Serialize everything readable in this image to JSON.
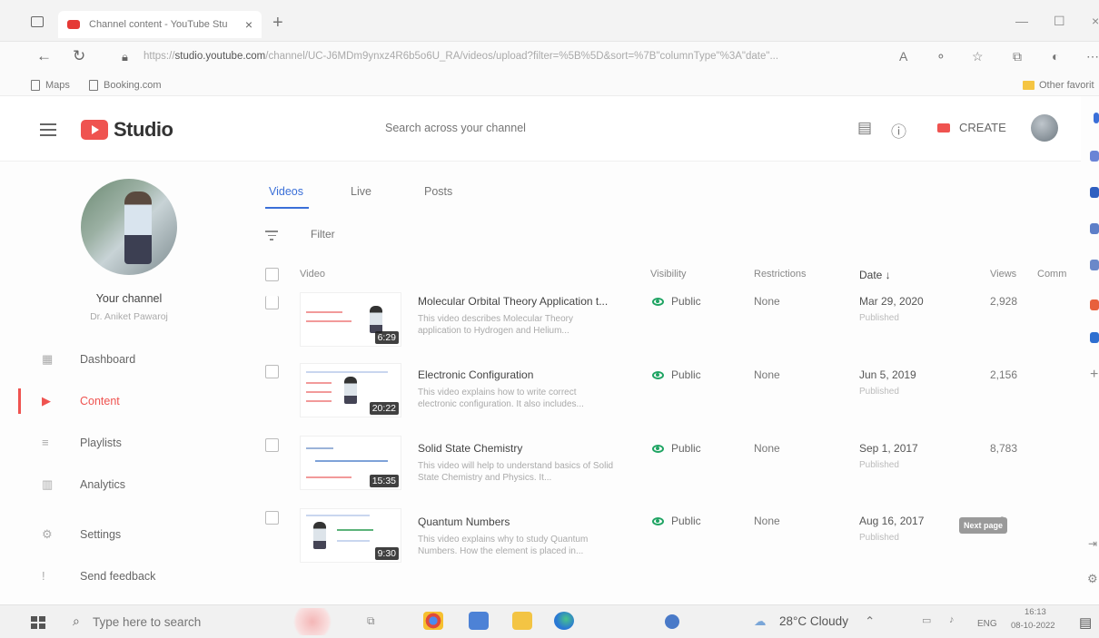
{
  "browser": {
    "tab_title": "Channel content - YouTube Stu",
    "tab_close": "×",
    "new_tab": "+",
    "url_prefix": "https://",
    "url_host": "studio.youtube.com",
    "url_rest": "/channel/UC-J6MDm9ynxz4R6b5o6U_RA/videos/upload?filter=%5B%5D&sort=%7B\"columnType\"%3A\"date\"...",
    "bookmarks": [
      "Maps",
      "Booking.com"
    ],
    "other_favorites": "Other favorit"
  },
  "studio": {
    "logo_text": "Studio",
    "search_placeholder": "Search across your channel",
    "create_label": "CREATE"
  },
  "sidebar": {
    "channel_label": "Your channel",
    "channel_name": "Dr. Aniket Pawaroj",
    "items": [
      {
        "label": "Dashboard",
        "icon": "▦"
      },
      {
        "label": "Content",
        "icon": "▶"
      },
      {
        "label": "Playlists",
        "icon": "≡"
      },
      {
        "label": "Analytics",
        "icon": "▥"
      },
      {
        "label": "Settings",
        "icon": "⚙"
      },
      {
        "label": "Send feedback",
        "icon": "!"
      }
    ]
  },
  "content": {
    "tabs": [
      "Videos",
      "Live",
      "Posts"
    ],
    "filter_placeholder": "Filter",
    "columns": {
      "video": "Video",
      "visibility": "Visibility",
      "restrictions": "Restrictions",
      "date": "Date ↓",
      "views": "Views",
      "comments": "Comm"
    },
    "videos": [
      {
        "title": "Molecular Orbital Theory Application t...",
        "description": "This video describes Molecular Theory application to Hydrogen and Helium...",
        "duration": "6:29",
        "visibility": "Public",
        "restrictions": "None",
        "date": "Mar 29, 2020",
        "status": "Published",
        "views": "2,928"
      },
      {
        "title": "Electronic Configuration",
        "description": "This video explains how to write correct electronic configuration. It also includes...",
        "duration": "20:22",
        "visibility": "Public",
        "restrictions": "None",
        "date": "Jun 5, 2019",
        "status": "Published",
        "views": "2,156"
      },
      {
        "title": "Solid State Chemistry",
        "description": "This video will help to understand basics of Solid State Chemistry and Physics. It...",
        "duration": "15:35",
        "visibility": "Public",
        "restrictions": "None",
        "date": "Sep 1, 2017",
        "status": "Published",
        "views": "8,783"
      },
      {
        "title": "Quantum Numbers",
        "description": "This video explains why to study Quantum Numbers. How the element is placed in...",
        "duration": "9:30",
        "visibility": "Public",
        "restrictions": "None",
        "date": "Aug 16, 2017",
        "status": "Published",
        "views": "3"
      }
    ],
    "next_page": "Next page"
  },
  "taskbar": {
    "search_placeholder": "Type here to search",
    "weather": "28°C Cloudy",
    "language": "ENG",
    "time": "16:13",
    "date": "08-10-2022"
  },
  "colors": {
    "accent_red": "#ef5350",
    "tab_blue": "#3a6fd8",
    "public_green": "#1fa463"
  }
}
